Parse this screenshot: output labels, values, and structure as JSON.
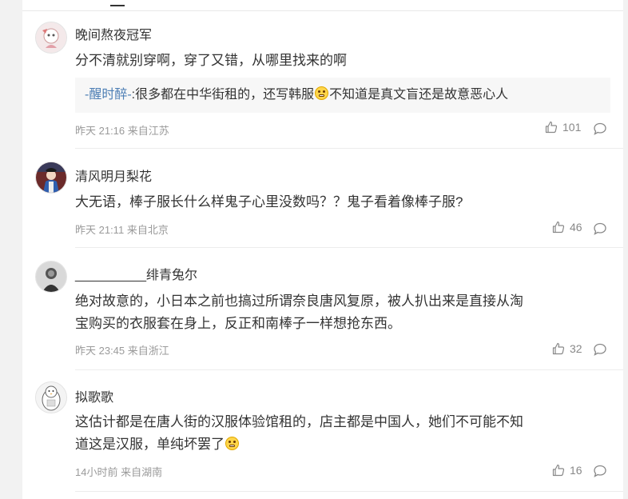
{
  "comments": [
    {
      "username": "晚间熬夜冠军",
      "text": "分不清就别穿啊，穿了又错，从哪里找来的啊",
      "quote": {
        "name": "-醒时醉-",
        "text_before": ":很多都在中华街租的，还写韩服",
        "emoji": "grin-emoji",
        "text_after": "不知道是真文盲还是故意恶心人"
      },
      "time": "昨天 21:16",
      "location": "来自江苏",
      "likes": "101"
    },
    {
      "username": "清风明月梨花",
      "text": "大无语，棒子服长什么样鬼子心里没数吗？？鬼子看着像棒子服?",
      "time": "昨天 21:11",
      "location": "来自北京",
      "likes": "46"
    },
    {
      "username": "__________绯青兔尔",
      "text_line1": "绝对故意的，小日本之前也搞过所谓奈良唐风复原，被人扒出来是直接从淘",
      "text_line2": "宝购买的衣服套在身上，反正和南棒子一样想抢东西。",
      "time": "昨天 23:45",
      "location": "来自浙江",
      "likes": "32"
    },
    {
      "username": "拟歌歌",
      "text_line1": "这估计都是在唐人街的汉服体验馆租的，店主都是中国人，她们不可能不知",
      "text_line2": "道这是汉服，单纯坏罢了",
      "emoji": "grin-emoji",
      "time": "14小时前",
      "location": "来自湖南",
      "likes": "16"
    }
  ],
  "icons": {
    "like": "thumbs-up-icon",
    "reply": "comment-bubble-icon"
  },
  "colors": {
    "page_bg": "#f2f2f2",
    "card_bg": "#ffffff",
    "text": "#333333",
    "meta": "#9a9a9a",
    "link": "#4e7fb5",
    "quote_bg": "#f7f7f7"
  }
}
